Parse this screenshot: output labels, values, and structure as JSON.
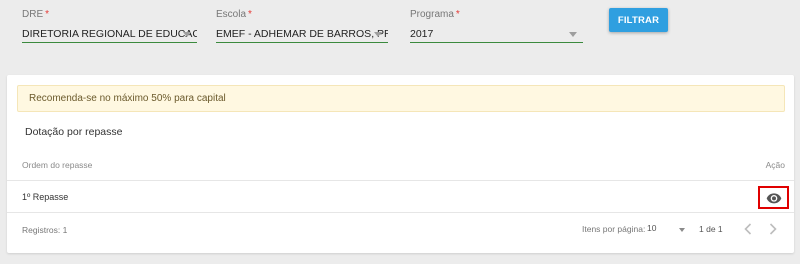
{
  "filters": {
    "dre": {
      "label": "DRE",
      "required_mark": "*",
      "value": "DIRETORIA REGIONAL DE EDUCACAO"
    },
    "escola": {
      "label": "Escola",
      "required_mark": "*",
      "value": "EMEF - ADHEMAR DE BARROS, PREF."
    },
    "programa": {
      "label": "Programa",
      "required_mark": "*",
      "value": "2017"
    },
    "submit_label": "FILTRAR"
  },
  "alert": {
    "text": "Recomenda-se no máximo 50% para capital"
  },
  "section": {
    "title": "Dotação por repasse"
  },
  "table": {
    "columns": [
      "Ordem do repasse",
      "Ação"
    ],
    "rows": [
      {
        "ordem": "1º Repasse",
        "action_icon": "eye-icon"
      }
    ]
  },
  "footer": {
    "records": "Registros: 1",
    "items_per_page_label": "Itens por página:",
    "items_per_page_value": "10",
    "range": "1 de 1"
  },
  "colors": {
    "primary": "#2f9fe0",
    "underline": "#3b8a3e",
    "highlight": "#e00000",
    "alert_bg": "#fff8e1"
  }
}
